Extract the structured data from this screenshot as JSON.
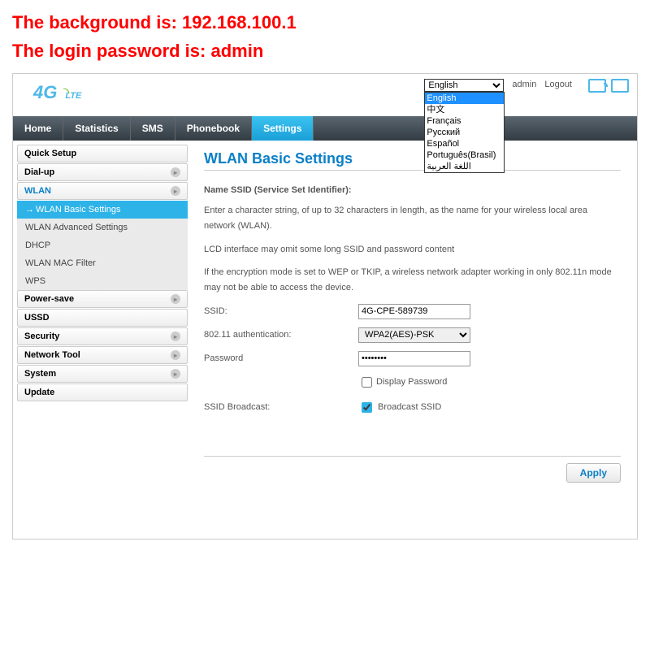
{
  "overlay": {
    "line1": "The background is: 192.168.100.1",
    "line2": "The login password is: admin"
  },
  "logo": {
    "main": "4G",
    "sub": "LTE"
  },
  "top": {
    "lang_selected": "English",
    "lang_options": [
      "English",
      "中文",
      "Français",
      "Русский",
      "Español",
      "Português(Brasil)",
      "اللغة العربية"
    ],
    "user": "admin",
    "logout": "Logout"
  },
  "nav": [
    "Home",
    "Statistics",
    "SMS",
    "Phonebook",
    "Settings"
  ],
  "sidebar": {
    "groups": [
      "Quick Setup",
      "Dial-up",
      "WLAN",
      "Power-save",
      "USSD",
      "Security",
      "Network Tool",
      "System",
      "Update"
    ],
    "wlan_subs": [
      "WLAN Basic Settings",
      "WLAN Advanced Settings",
      "DHCP",
      "WLAN MAC Filter",
      "WPS"
    ]
  },
  "main": {
    "title": "WLAN Basic Settings",
    "section": "Name SSID (Service Set Identifier):",
    "desc1": "Enter a character string, of up to 32 characters in length, as the name for your wireless local area network (WLAN).",
    "desc2": "LCD interface may omit some long SSID and password content",
    "desc3": "If the encryption mode is set to WEP or TKIP, a wireless network adapter working in only 802.11n mode may not be able to access the device.",
    "ssid_label": "SSID:",
    "ssid_value": "4G-CPE-589739",
    "auth_label": "802.11 authentication:",
    "auth_value": "WPA2(AES)-PSK",
    "pass_label": "Password",
    "pass_value": "********",
    "display_pass": "Display Password",
    "broadcast_label": "SSID Broadcast:",
    "broadcast_check": "Broadcast SSID",
    "apply": "Apply"
  }
}
